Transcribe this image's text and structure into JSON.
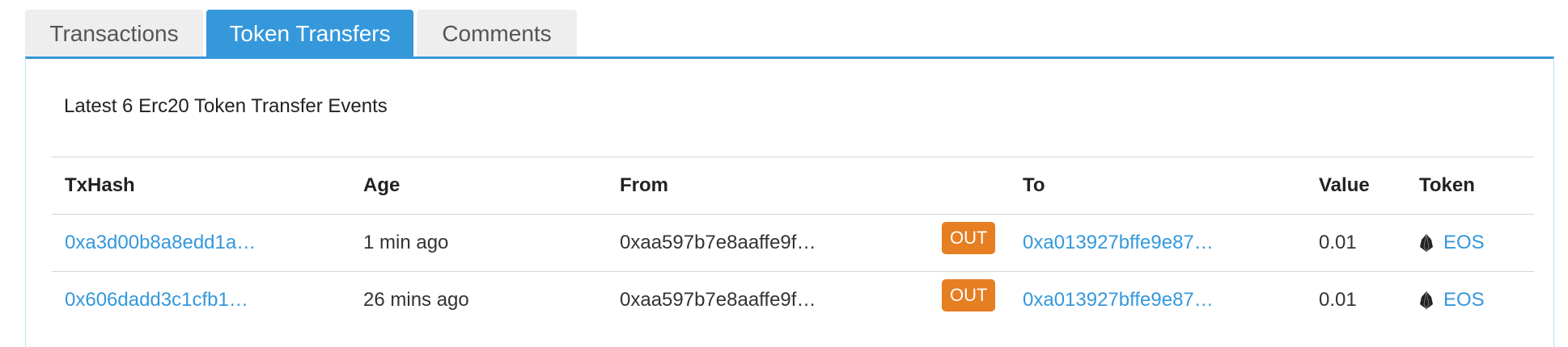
{
  "tabs": [
    {
      "label": "Transactions",
      "active": false
    },
    {
      "label": "Token Transfers",
      "active": true
    },
    {
      "label": "Comments",
      "active": false
    }
  ],
  "panel": {
    "subtitle": "Latest 6 Erc20 Token Transfer Events"
  },
  "table": {
    "headers": {
      "txhash": "TxHash",
      "age": "Age",
      "from": "From",
      "to": "To",
      "value": "Value",
      "token": "Token"
    },
    "rows": [
      {
        "txhash": "0xa3d00b8a8edd1a…",
        "age": "1 min ago",
        "from": "0xaa597b7e8aaffe9f…",
        "direction": "OUT",
        "to": "0xa013927bffe9e87…",
        "value": "0.01",
        "token": "EOS",
        "token_icon": "eos-icon"
      },
      {
        "txhash": "0x606dadd3c1cfb1…",
        "age": "26 mins ago",
        "from": "0xaa597b7e8aaffe9f…",
        "direction": "OUT",
        "to": "0xa013927bffe9e87…",
        "value": "0.01",
        "token": "EOS",
        "token_icon": "eos-icon"
      }
    ]
  },
  "colors": {
    "accent": "#3498db",
    "out_badge": "#e67e22",
    "tab_inactive": "#eeeeee"
  }
}
